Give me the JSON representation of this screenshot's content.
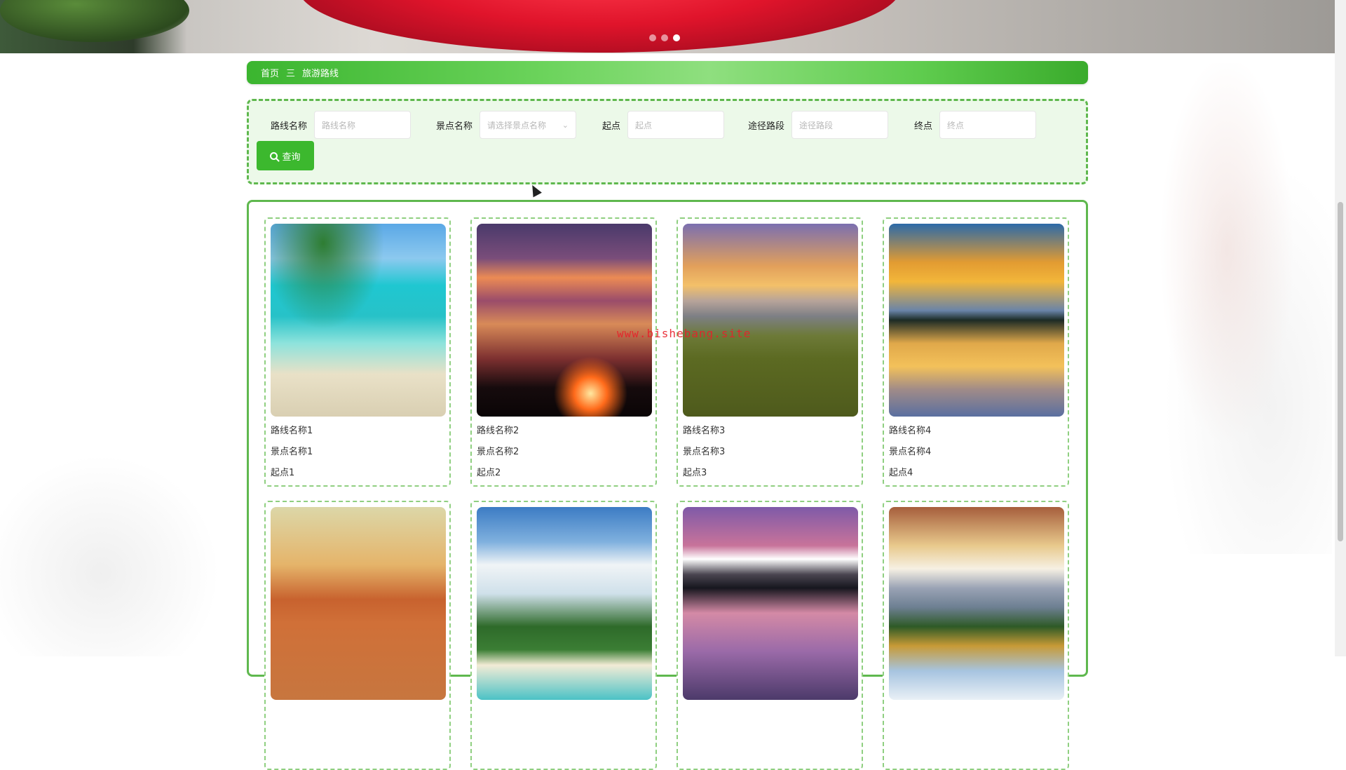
{
  "banner": {
    "carousel_dots": [
      {
        "active": false
      },
      {
        "active": false
      },
      {
        "active": true
      }
    ]
  },
  "breadcrumb": {
    "home": "首页",
    "separator": "三",
    "current": "旅游路线"
  },
  "search": {
    "fields": [
      {
        "label": "路线名称",
        "placeholder": "路线名称",
        "type": "input"
      },
      {
        "label": "景点名称",
        "placeholder": "请选择景点名称",
        "type": "select"
      },
      {
        "label": "起点",
        "placeholder": "起点",
        "type": "input"
      },
      {
        "label": "途径路段",
        "placeholder": "途径路段",
        "type": "input"
      },
      {
        "label": "终点",
        "placeholder": "终点",
        "type": "input"
      }
    ],
    "query_label": "查询"
  },
  "routes": [
    {
      "route_name": "路线名称1",
      "spot_name": "景点名称1",
      "start": "起点1",
      "image": "beach-palm"
    },
    {
      "route_name": "路线名称2",
      "spot_name": "景点名称2",
      "start": "起点2",
      "image": "sunset-trees"
    },
    {
      "route_name": "路线名称3",
      "spot_name": "景点名称3",
      "start": "起点3",
      "image": "mountain-meadow"
    },
    {
      "route_name": "路线名称4",
      "spot_name": "景点名称4",
      "start": "起点4",
      "image": "lake-sunset"
    },
    {
      "image": "desert"
    },
    {
      "image": "tropical-beach"
    },
    {
      "image": "mountain-lake-dusk"
    },
    {
      "image": "alpine-lake"
    }
  ],
  "watermark": "www.bishebang.site",
  "colors": {
    "accent_green": "#3cb82e",
    "panel_bg": "#ecf9e9",
    "watermark_red": "#e8202a"
  }
}
